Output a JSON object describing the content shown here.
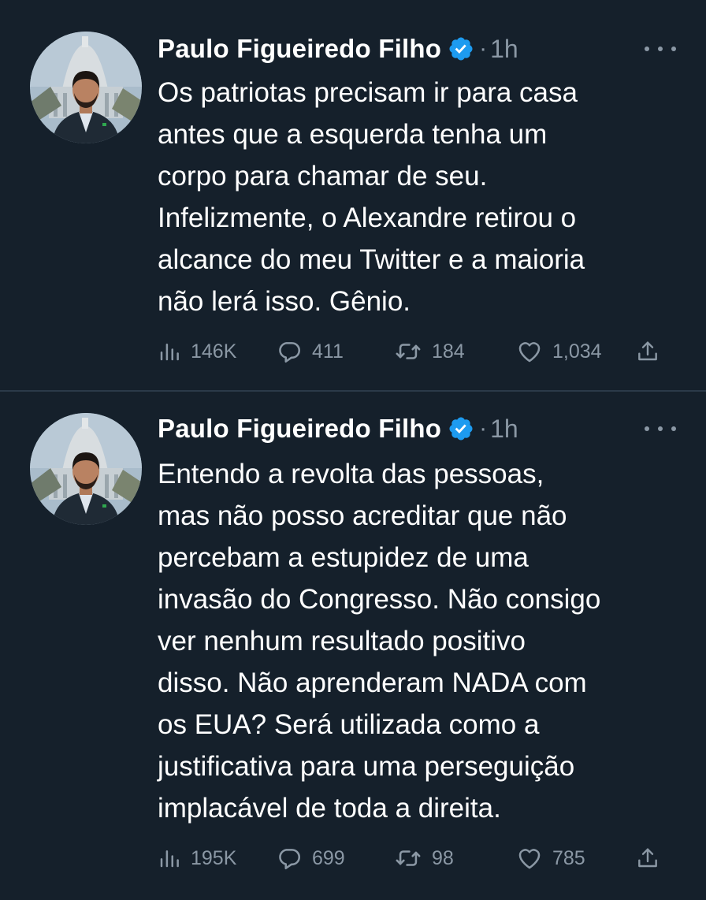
{
  "tweets": [
    {
      "author": "Paulo Figueiredo Filho",
      "separator": "·",
      "time": "1h",
      "text_lines": [
        "Os patriotas precisam ir para casa",
        "antes que a esquerda tenha um",
        "corpo para chamar de seu.",
        "Infelizmente, o Alexandre retirou o",
        "alcance do meu Twitter e a maioria",
        "não lerá isso. Gênio."
      ],
      "views": "146K",
      "replies": "411",
      "retweets": "184",
      "likes": "1,034"
    },
    {
      "author": "Paulo Figueiredo Filho",
      "separator": "·",
      "time": "1h",
      "text_lines": [
        "Entendo a revolta das pessoas,",
        "mas não posso acreditar que não",
        "percebam a estupidez de uma",
        "invasão do Congresso. Não consigo",
        "ver nenhum resultado positivo",
        "disso. Não aprenderam NADA com",
        "os EUA? Será utilizada como a",
        "justificativa para uma perseguição",
        "implacável de toda a direita."
      ],
      "views": "195K",
      "replies": "699",
      "retweets": "98",
      "likes": "785"
    }
  ],
  "icons": {
    "verified": "verified-badge-icon",
    "more": "more-options-icon",
    "views": "views-chart-icon",
    "reply": "reply-bubble-icon",
    "retweet": "retweet-icon",
    "like": "heart-icon",
    "share": "share-upload-icon"
  },
  "colors": {
    "background": "#15202b",
    "text": "#ffffff",
    "muted": "#8b98a5",
    "verified": "#1d9bf0",
    "divider": "#2b3a49"
  }
}
